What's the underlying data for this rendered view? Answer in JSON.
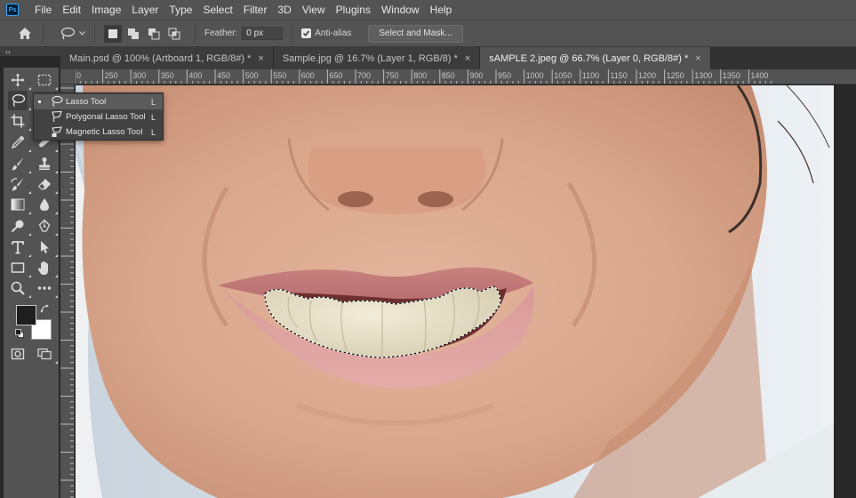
{
  "app": {
    "logo_text": "Ps"
  },
  "menu": [
    "File",
    "Edit",
    "Image",
    "Layer",
    "Type",
    "Select",
    "Filter",
    "3D",
    "View",
    "Plugins",
    "Window",
    "Help"
  ],
  "options": {
    "feather_label": "Feather:",
    "feather_value": "0 px",
    "antialias_label": "Anti-alias",
    "antialias_checked": true,
    "select_mask_label": "Select and Mask..."
  },
  "panel": {
    "collapse_glyph": "‹‹"
  },
  "tabs": [
    {
      "label": "Main.psd @ 100% (Artboard 1, RGB/8#) *",
      "close": "×",
      "active": false
    },
    {
      "label": "Sample.jpg @ 16.7% (Layer 1, RGB/8) *",
      "close": "×",
      "active": false
    },
    {
      "label": "sAMPLE 2.jpeg @ 66.7% (Layer 0, RGB/8#) *",
      "close": "×",
      "active": true
    }
  ],
  "ruler": {
    "h_labels": [
      "0",
      "250",
      "300",
      "350",
      "400",
      "450",
      "500",
      "550",
      "600",
      "650",
      "700",
      "750",
      "800",
      "850",
      "900",
      "950",
      "1000",
      "1050",
      "1100",
      "1150",
      "1200",
      "1250",
      "1300",
      "1350",
      "1400"
    ]
  },
  "flyout": [
    {
      "label": "Lasso Tool",
      "shortcut": "L",
      "selected": true
    },
    {
      "label": "Polygonal Lasso Tool",
      "shortcut": "L",
      "selected": false
    },
    {
      "label": "Magnetic Lasso Tool",
      "shortcut": "L",
      "selected": false
    }
  ],
  "colors": {
    "foreground": "#1e1e1e",
    "background": "#ffffff",
    "ui_dark": "#535353",
    "accent": "#31a8ff"
  }
}
